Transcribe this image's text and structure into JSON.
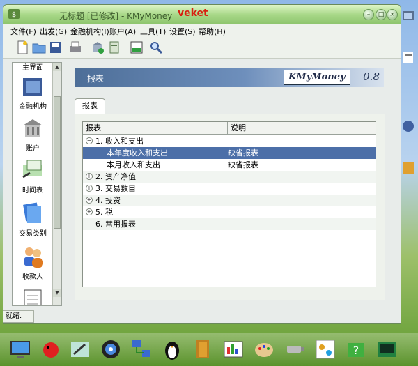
{
  "window": {
    "title": "无标题 [已修改] - KMyMoney",
    "watermark": "veket"
  },
  "menu": [
    "文件(F)",
    "出发(G)",
    "金融机构(I)",
    "账户(A)",
    "工具(T)",
    "设置(S)",
    "帮助(H)"
  ],
  "toolbar": {
    "icons": [
      "new-file-icon",
      "open-folder-icon",
      "save-icon",
      "print-icon",
      "new-institution-icon",
      "new-account-icon",
      "export-icon",
      "find-transaction-icon"
    ]
  },
  "sidebar": {
    "items": [
      {
        "label": "主界面",
        "icon": "home-icon"
      },
      {
        "label": "金融机构",
        "icon": "institutions-icon"
      },
      {
        "label": "账户",
        "icon": "accounts-icon"
      },
      {
        "label": "时间表",
        "icon": "schedule-icon"
      },
      {
        "label": "交易类别",
        "icon": "categories-icon"
      },
      {
        "label": "收款人",
        "icon": "payees-icon"
      },
      {
        "label": "",
        "icon": "ledger-icon"
      }
    ]
  },
  "banner": {
    "title": "报表",
    "logo": "KMyMoney",
    "version": "0.8"
  },
  "tab": {
    "label": "报表"
  },
  "report_list": {
    "headers": [
      "报表",
      "说明"
    ],
    "rows": [
      {
        "expander": "-",
        "name": "1. 收入和支出",
        "desc": "",
        "level": 0
      },
      {
        "expander": "",
        "name": "本年度收入和支出",
        "desc": "缺省报表",
        "level": 1,
        "selected": true
      },
      {
        "expander": "",
        "name": "本月收入和支出",
        "desc": "缺省报表",
        "level": 1
      },
      {
        "expander": "+",
        "name": "2. 资产净值",
        "desc": "",
        "level": 0
      },
      {
        "expander": "+",
        "name": "3. 交易数目",
        "desc": "",
        "level": 0
      },
      {
        "expander": "+",
        "name": "4. 投资",
        "desc": "",
        "level": 0
      },
      {
        "expander": "+",
        "name": "5. 税",
        "desc": "",
        "level": 0
      },
      {
        "expander": "",
        "name": "6. 常用报表",
        "desc": "",
        "level": 0
      }
    ]
  },
  "status": {
    "text": "就绪."
  },
  "dock": {
    "icons": [
      "monitor-icon",
      "bug-icon",
      "paint-icon",
      "media-player-icon",
      "network-icon",
      "penguin-icon",
      "file-manager-icon",
      "image-viewer-icon",
      "palette-icon",
      "usb-drive-icon",
      "game-icon",
      "puzzle-icon",
      "terminal-icon"
    ]
  },
  "colors": {
    "selection": "#4c6fa8",
    "banner": "#5a7ba8",
    "title_watermark": "#d82010",
    "titlebar": "#a8d888"
  }
}
